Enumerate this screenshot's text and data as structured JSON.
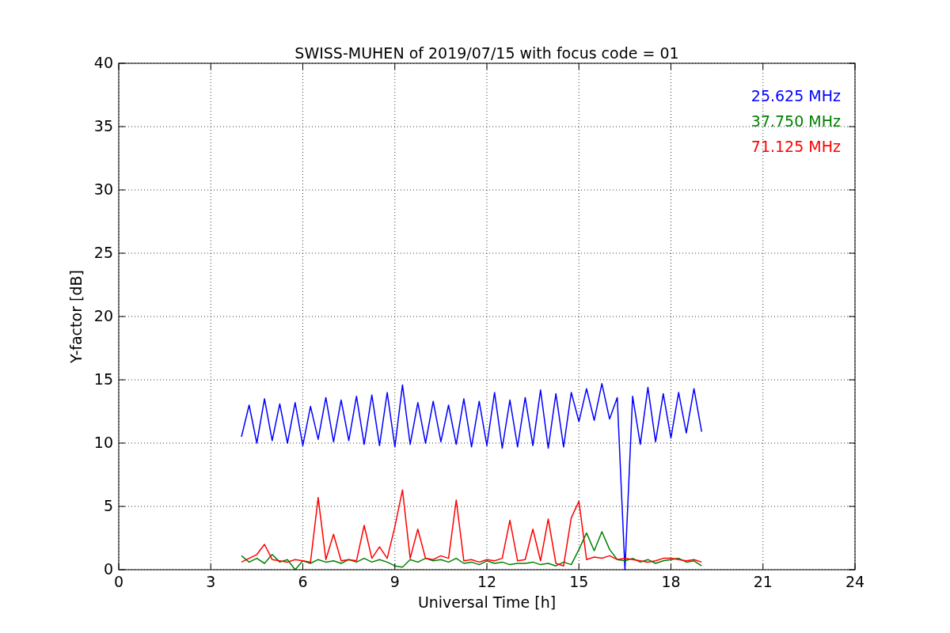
{
  "figure": {
    "chart_data": {
      "type": "line",
      "title": "SWISS-MUHEN of 2019/07/15 with focus code = 01",
      "xlabel": "Universal Time [h]",
      "ylabel": "Y-factor [dB]",
      "x": [
        4,
        4.25,
        4.5,
        4.75,
        5,
        5.25,
        5.5,
        5.75,
        6,
        6.25,
        6.5,
        6.75,
        7,
        7.25,
        7.5,
        7.75,
        8,
        8.25,
        8.5,
        8.75,
        9,
        9.25,
        9.5,
        9.75,
        10,
        10.25,
        10.5,
        10.75,
        11,
        11.25,
        11.5,
        11.75,
        12,
        12.25,
        12.5,
        12.75,
        13,
        13.25,
        13.5,
        13.75,
        14,
        14.25,
        14.5,
        14.75,
        15,
        15.25,
        15.5,
        15.75,
        16,
        16.25,
        16.5,
        16.75,
        17,
        17.25,
        17.5,
        17.75,
        18,
        18.25,
        18.5,
        18.75,
        19
      ],
      "series": [
        {
          "name": "25.625 MHz",
          "color": "#0000ff",
          "values": [
            10.5,
            13.0,
            10.0,
            13.5,
            10.2,
            13.1,
            10.0,
            13.2,
            9.8,
            12.9,
            10.3,
            13.6,
            10.1,
            13.4,
            10.2,
            13.7,
            9.9,
            13.8,
            9.8,
            14.0,
            9.7,
            14.6,
            9.9,
            13.2,
            10.0,
            13.3,
            10.1,
            13.0,
            9.9,
            13.5,
            9.7,
            13.3,
            9.8,
            14.0,
            9.6,
            13.4,
            9.7,
            13.6,
            9.8,
            14.2,
            9.6,
            13.9,
            9.7,
            14.0,
            11.7,
            14.3,
            11.8,
            14.7,
            11.9,
            13.6,
            0.0,
            13.7,
            9.9,
            14.4,
            10.1,
            13.9,
            10.4,
            14.0,
            10.8,
            14.3,
            10.9
          ]
        },
        {
          "name": "37.750 MHz",
          "color": "#008000",
          "values": [
            1.1,
            0.6,
            0.9,
            0.5,
            1.2,
            0.6,
            0.8,
            0.0,
            0.7,
            0.5,
            0.8,
            0.6,
            0.7,
            0.5,
            0.8,
            0.6,
            0.9,
            0.6,
            0.8,
            0.6,
            0.3,
            0.2,
            0.8,
            0.6,
            0.9,
            0.7,
            0.8,
            0.6,
            0.9,
            0.5,
            0.6,
            0.4,
            0.7,
            0.5,
            0.6,
            0.4,
            0.5,
            0.5,
            0.6,
            0.4,
            0.5,
            0.3,
            0.6,
            0.4,
            1.6,
            2.9,
            1.5,
            3.0,
            1.6,
            0.8,
            0.7,
            0.9,
            0.6,
            0.8,
            0.5,
            0.7,
            0.8,
            0.9,
            0.6,
            0.7,
            0.3
          ]
        },
        {
          "name": "71.125 MHz",
          "color": "#ff0000",
          "values": [
            0.6,
            0.9,
            1.2,
            2.0,
            0.8,
            0.7,
            0.6,
            0.8,
            0.7,
            0.6,
            5.7,
            0.8,
            2.8,
            0.7,
            0.8,
            0.7,
            3.5,
            0.9,
            1.8,
            0.9,
            3.4,
            6.3,
            0.9,
            3.2,
            0.9,
            0.8,
            1.1,
            0.9,
            5.5,
            0.7,
            0.8,
            0.6,
            0.8,
            0.7,
            0.9,
            3.9,
            0.7,
            0.8,
            3.2,
            0.7,
            4.0,
            0.5,
            0.3,
            4.1,
            5.4,
            0.8,
            1.0,
            0.9,
            1.1,
            0.8,
            0.9,
            0.8,
            0.7,
            0.6,
            0.7,
            0.9,
            0.9,
            0.8,
            0.7,
            0.8,
            0.6
          ]
        }
      ],
      "grid": true,
      "xlim": [
        0,
        24
      ],
      "ylim": [
        0,
        40
      ],
      "xticks": [
        0,
        3,
        6,
        9,
        12,
        15,
        18,
        21,
        24
      ],
      "yticks": [
        0,
        5,
        10,
        15,
        20,
        25,
        30,
        35,
        40
      ]
    }
  }
}
